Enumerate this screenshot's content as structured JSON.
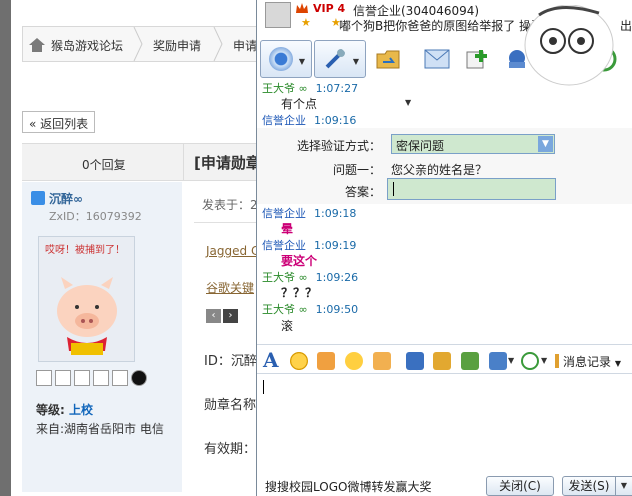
{
  "forum": {
    "breadcrumb": [
      "猴岛游戏论坛",
      "奖励申请",
      "申请"
    ],
    "back_label": "« 返回列表",
    "reply_count": "0个回复",
    "thread_title": "[申请勋章",
    "author": {
      "name": "沉醉∞",
      "zxid": "ZxID：16079392",
      "avatar_caption": "哎呀！被捕到了！",
      "level_label": "等级:",
      "level_value": "上校",
      "from": "来自:湖南省岳阳市 电信"
    },
    "post": {
      "meta": "发表于：2",
      "link1": "Jagged C",
      "link2": "谷歌关键",
      "field_id": "ID：沉醉",
      "field_medal": "勋章名称",
      "field_valid": "有效期："
    }
  },
  "chat": {
    "vip": "VIP 4",
    "contact_name": "信誉企业(304046094)",
    "signature": "嘟个狗B把你爸爸的原图给举报了  操蛋~!",
    "signature_cut": "出",
    "messages": [
      {
        "sender": "王大爷 ∞",
        "time": "1:07:27",
        "text": "有个点",
        "sender_color": "green"
      },
      {
        "sender": "信誉企业",
        "time": "1:09:16",
        "text": "",
        "sender_color": "blue"
      },
      {
        "sender": "信誉企业",
        "time": "1:09:18",
        "text": "晕",
        "sender_color": "blue"
      },
      {
        "sender": "信誉企业",
        "time": "1:09:19",
        "text": "要这个",
        "sender_color": "blue"
      },
      {
        "sender": "王大爷 ∞",
        "time": "1:09:26",
        "text": "？？？",
        "sender_color": "green"
      },
      {
        "sender": "王大爷 ∞",
        "time": "1:09:50",
        "text": "滚",
        "sender_color": "green"
      }
    ],
    "verify": {
      "method_label": "选择验证方式：",
      "method_value": "密保问题",
      "question_label": "问题一：",
      "question_text": "您父亲的姓名是？",
      "answer_label": "答案："
    },
    "msg_record": "消息记录",
    "ad_text": "搜搜校园LOGO微博转发赢大奖",
    "close_label": "关闭(C)",
    "send_label": "发送(S)"
  },
  "colors": {
    "accent_blue": "#1a55b5",
    "accent_green": "#2a8a2a",
    "pink_text": "#cc0077",
    "input_bg": "#cfe8cf"
  }
}
